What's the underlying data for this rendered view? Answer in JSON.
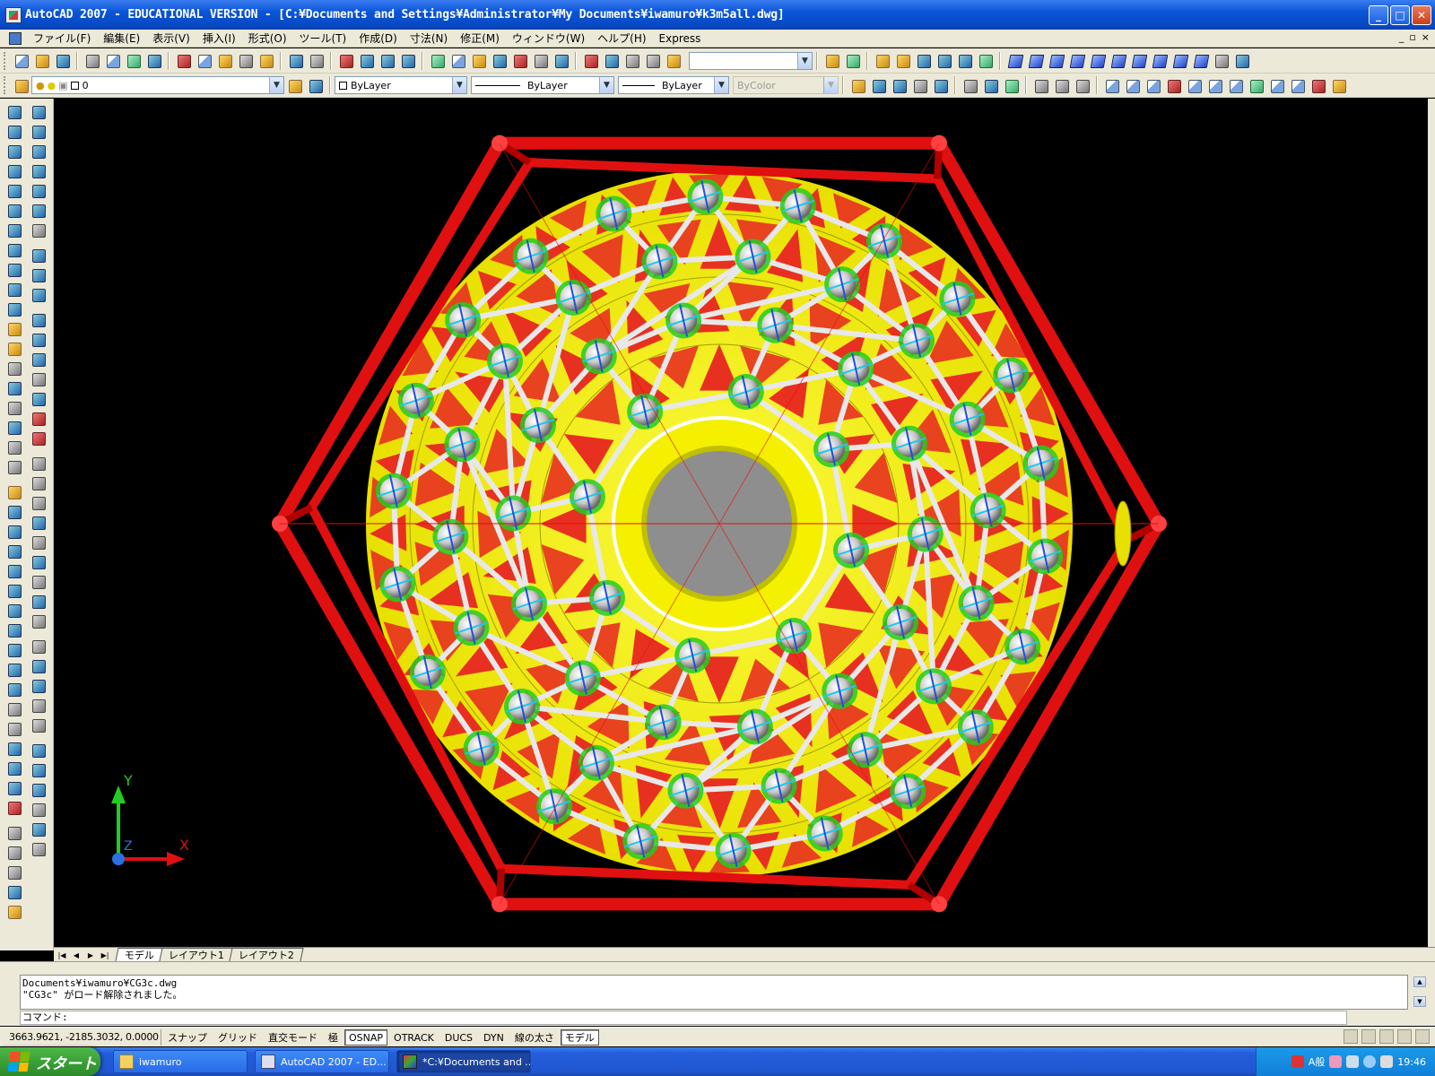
{
  "window": {
    "title": "AutoCAD 2007 - EDUCATIONAL VERSION - [C:¥Documents and Settings¥Administrator¥My Documents¥iwamuro¥k3m5all.dwg]",
    "minimize": "_",
    "maximize": "□",
    "close": "✕"
  },
  "menu": {
    "items": [
      "ファイル(F)",
      "編集(E)",
      "表示(V)",
      "挿入(I)",
      "形式(O)",
      "ツール(T)",
      "作成(D)",
      "寸法(N)",
      "修正(M)",
      "ウィンドウ(W)",
      "ヘルプ(H)",
      "Express"
    ],
    "mdi_minimize": "_",
    "mdi_restore": "▫",
    "mdi_close": "×"
  },
  "toolbar": {
    "layer_value": "0",
    "color_value": "ByLayer",
    "linetype_value": "ByLayer",
    "lineweight_value": "ByLayer",
    "plotstyle_value": "ByColor",
    "style_combo_value": ""
  },
  "layout_tabs": {
    "nav": [
      "|◀",
      "◀",
      "▶",
      "▶|"
    ],
    "tabs": [
      "モデル",
      "レイアウト1",
      "レイアウト2"
    ],
    "active": "モデル"
  },
  "command": {
    "history": [
      "Documents¥iwamuro¥CG3c.dwg",
      "\"CG3c\" がロード解除されました。"
    ],
    "prompt": "コマンド:"
  },
  "status": {
    "coords": "3663.9621, -2185.3032, 0.0000",
    "buttons": [
      {
        "label": "スナップ",
        "on": false
      },
      {
        "label": "グリッド",
        "on": false
      },
      {
        "label": "直交モード",
        "on": false
      },
      {
        "label": "極",
        "on": false
      },
      {
        "label": "OSNAP",
        "on": true
      },
      {
        "label": "OTRACK",
        "on": false
      },
      {
        "label": "DUCS",
        "on": false
      },
      {
        "label": "DYN",
        "on": false
      },
      {
        "label": "線の太さ",
        "on": false
      },
      {
        "label": "モデル",
        "on": true
      }
    ]
  },
  "ucs": {
    "x_label": "X",
    "y_label": "Y",
    "z_label": "Z"
  },
  "taskbar": {
    "start_label": "スタート",
    "items": [
      {
        "label": "iwamuro",
        "icon": "folder-icon",
        "active": false
      },
      {
        "label": "AutoCAD 2007 - ED...",
        "icon": "autocad-icon",
        "active": false
      },
      {
        "label": "*C:¥Documents and ...",
        "icon": "paint-icon",
        "active": true
      }
    ],
    "ime": "A般",
    "clock": "19:46"
  },
  "colors": {
    "frame_red": "#e01010",
    "panel_yellow": "#f4f000",
    "panel_red": "#e83020",
    "node_white": "#e8e8e8",
    "core_gray": "#909090",
    "accent_green": "#22cc22",
    "accent_cyan": "#20c8e8"
  }
}
